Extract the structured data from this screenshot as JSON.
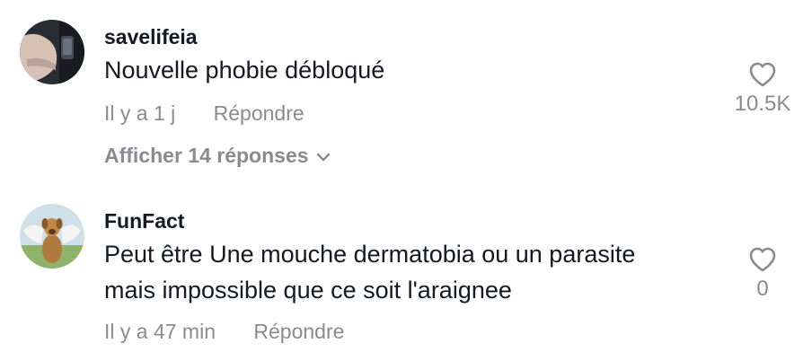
{
  "comments": [
    {
      "username": "savelifeia",
      "text_lines": [
        "Nouvelle phobie débloqué"
      ],
      "time": "Il y a 1 j",
      "reply_label": "Répondre",
      "likes": "10.5K",
      "view_replies": "Afficher 14 réponses"
    },
    {
      "username": "FunFact",
      "text_lines": [
        "Peut être Une mouche dermatobia ou un parasite",
        "mais impossible que ce soit l'araignee"
      ],
      "time": "Il y a 47 min",
      "reply_label": "Répondre",
      "likes": "0"
    }
  ],
  "colors": {
    "text": "#161823",
    "muted": "#8a8b91"
  },
  "icons": {
    "like": "heart-outline-icon",
    "expand": "chevron-down-icon"
  }
}
